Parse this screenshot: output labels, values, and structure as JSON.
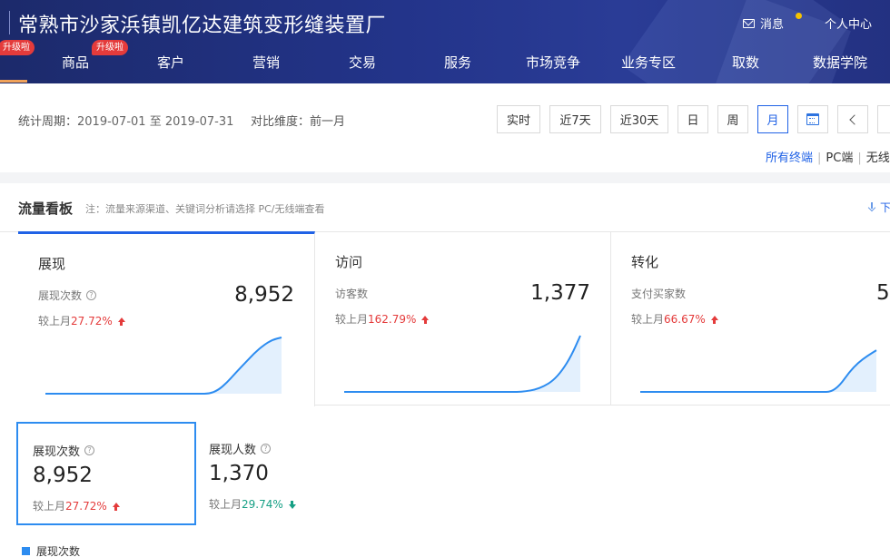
{
  "header": {
    "shop_name": "常熟市沙家浜镇凯亿达建筑变形缝装置厂",
    "messages_label": "消息",
    "user_center_label": "个人中心",
    "badges": [
      "升级啦",
      "升级啦"
    ],
    "nav": [
      "商品",
      "客户",
      "营销",
      "交易",
      "服务",
      "市场竞争",
      "业务专区",
      "取数",
      "数据学院"
    ]
  },
  "toolbar": {
    "period_label": "统计周期：",
    "period_value": "2019-07-01 至 2019-07-31",
    "compare_label": "对比维度：",
    "compare_value": "前一月",
    "buttons": [
      "实时",
      "近7天",
      "近30天",
      "日",
      "周",
      "月"
    ],
    "active_button": "月",
    "terminals": [
      "所有终端",
      "PC端",
      "无线"
    ]
  },
  "board": {
    "title": "流量看板",
    "note": "注：流量来源渠道、关键词分析请选择 PC/无线端查看",
    "download_label": "下",
    "cards": [
      {
        "title": "展现",
        "metric": "展现次数",
        "value": "8,952",
        "compare_prefix": "较上月",
        "compare_value": "27.72%",
        "trend": "up",
        "spark": [
          0,
          0,
          0,
          0,
          0,
          0,
          0,
          0,
          0,
          0,
          0,
          0,
          0,
          0,
          0,
          0,
          0,
          0,
          0,
          0.06,
          0.2,
          0.38,
          0.55,
          0.72,
          0.86,
          0.96,
          1.0
        ]
      },
      {
        "title": "访问",
        "metric": "访客数",
        "value": "1,377",
        "compare_prefix": "较上月",
        "compare_value": "162.79%",
        "trend": "up",
        "spark": [
          0,
          0,
          0,
          0,
          0,
          0,
          0,
          0,
          0,
          0,
          0,
          0,
          0,
          0,
          0,
          0,
          0,
          0,
          0,
          0,
          0.01,
          0.04,
          0.1,
          0.2,
          0.38,
          0.64,
          1.0
        ]
      },
      {
        "title": "转化",
        "metric": "支付买家数",
        "value": "5",
        "compare_prefix": "较上月",
        "compare_value": "66.67%",
        "trend": "up",
        "spark": [
          0,
          0,
          0,
          0,
          0,
          0,
          0,
          0,
          0,
          0,
          0,
          0,
          0,
          0,
          0,
          0,
          0,
          0,
          0,
          0,
          0,
          0,
          0.12,
          0.35,
          0.52,
          0.64,
          0.74
        ]
      }
    ],
    "sub_metrics": [
      {
        "label": "展现次数",
        "value": "8,952",
        "compare_prefix": "较上月",
        "compare_value": "27.72%",
        "trend": "up"
      },
      {
        "label": "展现人数",
        "value": "1,370",
        "compare_prefix": "较上月",
        "compare_value": "29.74%",
        "trend": "down"
      }
    ],
    "legend_label": "展现次数"
  },
  "colors": {
    "accent": "#2062e6",
    "up": "#e43b3b",
    "down": "#16a085",
    "line": "#2d8cf0",
    "fill": "#e3f0fd"
  }
}
